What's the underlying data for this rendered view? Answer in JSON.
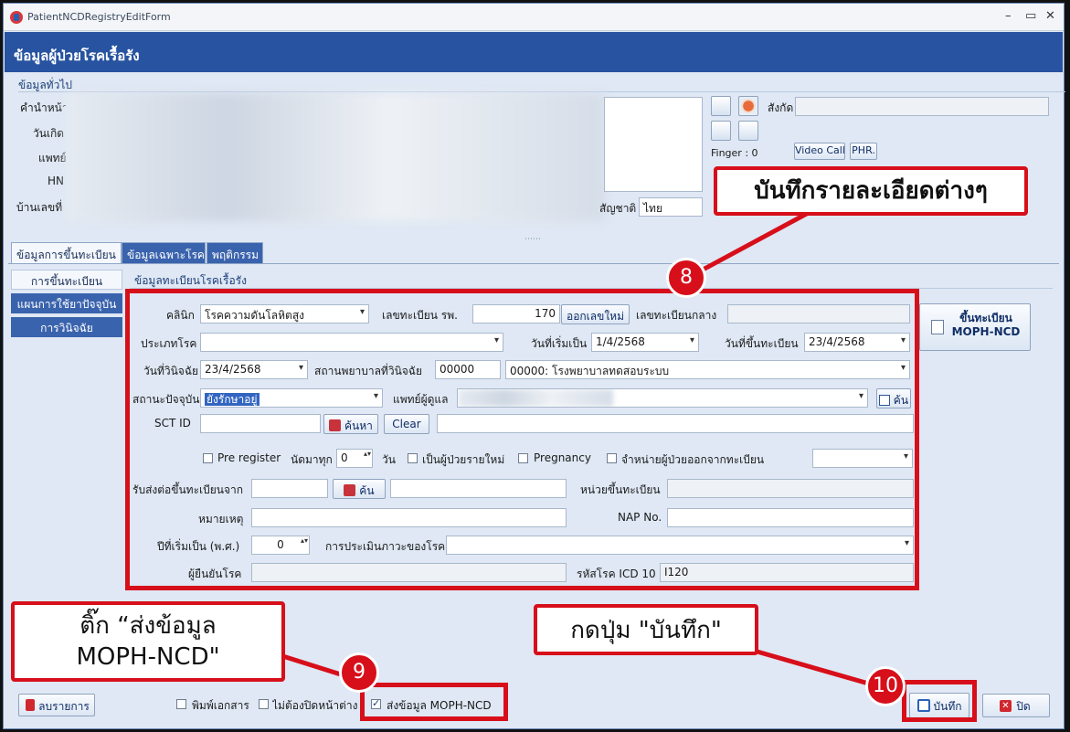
{
  "window": {
    "title": "PatientNCDRegistryEditForm",
    "header": "ข้อมูลผู้ป่วยโรคเรื้อรัง"
  },
  "general": {
    "group_title": "ข้อมูลทั่วไป",
    "labels": {
      "prefix": "คำนำหน้า",
      "dob": "วันเกิด",
      "doctor": "แพทย์",
      "hn": "HN",
      "address": "บ้านเลขที่"
    },
    "affiliation_label": "สังกัด",
    "finger_label": "Finger : 0",
    "video_call": "Video Call",
    "phr": "PHR.",
    "nationality_label": "สัญชาติ",
    "nationality_value": "ไทย"
  },
  "tabs": [
    "ข้อมูลการขึ้นทะเบียน",
    "ข้อมูลเฉพาะโรค",
    "พฤติกรรม"
  ],
  "side_nav": [
    "การขึ้นทะเบียน",
    "แผนการใช้ยาปัจจุบัน",
    "การวินิจฉัย"
  ],
  "section_title": "ข้อมูลทะเบียนโรคเรื้อรัง",
  "form": {
    "clinic_label": "คลินิก",
    "clinic_value": "โรคความดันโลหิตสูง",
    "hosp_reg_label": "เลขทะเบียน รพ.",
    "hosp_reg_value": "170",
    "issue_btn": "ออกเลขใหม่",
    "central_reg_label": "เลขทะเบียนกลาง",
    "disease_type_label": "ประเภทโรค",
    "start_date_label": "วันที่เริ่มเป็น",
    "start_date_value": "1/4/2568",
    "register_date_label": "วันที่ขึ้นทะเบียน",
    "register_date_value": "23/4/2568",
    "diag_date_label": "วันที่วินิจฉัย",
    "diag_date_value": "23/4/2568",
    "diag_hosp_label": "สถานพยาบาลที่วินิจฉัย",
    "diag_hosp_code": "00000",
    "diag_hosp_value": "00000: โรงพยาบาลทดสอบระบบ",
    "status_label": "สถานะปัจจุบัน",
    "status_value": "ยังรักษาอยู่",
    "doctor_label": "แพทย์ผู้ดูแล",
    "search_short": "ค้น",
    "sct_label": "SCT ID",
    "search_btn": "ค้นหา",
    "clear_btn": "Clear",
    "pre_register": "Pre register",
    "appoint_every": "นัดมาทุก",
    "appoint_value": "0",
    "day_unit": "วัน",
    "new_patient": "เป็นผู้ป่วยรายใหม่",
    "pregnancy": "Pregnancy",
    "discharge": "จำหน่ายผู้ป่วยออกจากทะเบียน",
    "referral_label": "รับส่งต่อขึ้นทะเบียนจาก",
    "unit_label": "หน่วยขึ้นทะเบียน",
    "note_label": "หมายเหตุ",
    "nap_label": "NAP No.",
    "start_year_label": "ปีที่เริ่มเป็น (พ.ศ.)",
    "start_year_value": "0",
    "assess_label": "การประเมินภาวะของโรค",
    "confirmer_label": "ผู้ยืนยันโรค",
    "icd_label": "รหัสโรค ICD 10",
    "icd_value": "I120"
  },
  "register_btn": {
    "line1": "ขึ้นทะเบียน",
    "line2": "MOPH-NCD"
  },
  "footer": {
    "delete_btn": "ลบรายการ",
    "print_doc": "พิมพ์เอกสาร",
    "no_close": "ไม่ต้องปิดหน้าต่าง",
    "send_moph": "ส่งข้อมูล MOPH-NCD",
    "save_btn": "บันทึก",
    "close_btn": "ปิด"
  },
  "annotations": {
    "callout_details": "บันทึกรายละเอียดต่างๆ",
    "callout_tick_line1": "ติ๊ก “ส่งข้อมูล",
    "callout_tick_line2": "MOPH-NCD\"",
    "callout_save": "กดปุ่ม \"บันทึก\"",
    "badge8": "8",
    "badge9": "9",
    "badge10": "10"
  }
}
